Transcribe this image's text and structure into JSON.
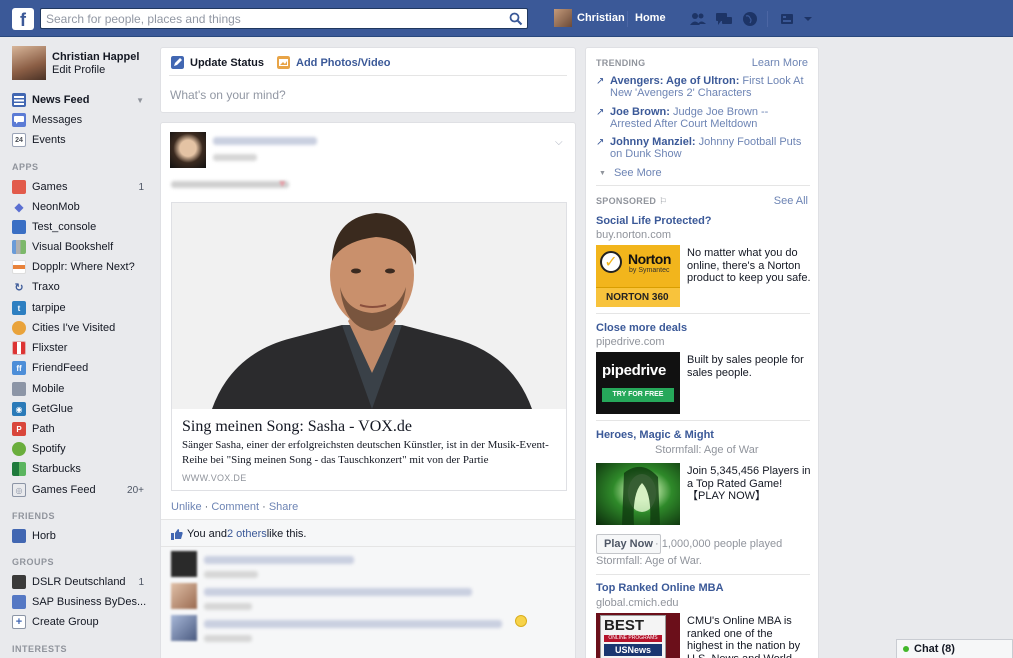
{
  "topbar": {
    "logo": "f",
    "search_placeholder": "Search for people, places and things",
    "user_name": "Christian",
    "home_label": "Home"
  },
  "profile": {
    "name": "Christian Happel",
    "edit_label": "Edit Profile"
  },
  "nav": {
    "favorites": [
      {
        "label": "News Feed",
        "icon": "newsfeed-icon"
      },
      {
        "label": "Messages",
        "icon": "messages-icon"
      },
      {
        "label": "Events",
        "icon": "events-icon",
        "icon_text": "24"
      }
    ],
    "apps_header": "APPS",
    "apps": [
      {
        "label": "Games",
        "count": "1"
      },
      {
        "label": "NeonMob",
        "count": ""
      },
      {
        "label": "Test_console",
        "count": ""
      },
      {
        "label": "Visual Bookshelf",
        "count": ""
      },
      {
        "label": "Dopplr: Where Next?",
        "count": ""
      },
      {
        "label": "Traxo",
        "count": ""
      },
      {
        "label": "tarpipe",
        "count": ""
      },
      {
        "label": "Cities I've Visited",
        "count": ""
      },
      {
        "label": "Flixster",
        "count": ""
      },
      {
        "label": "FriendFeed",
        "count": ""
      },
      {
        "label": "Mobile",
        "count": ""
      },
      {
        "label": "GetGlue",
        "count": ""
      },
      {
        "label": "Path",
        "count": ""
      },
      {
        "label": "Spotify",
        "count": ""
      },
      {
        "label": "Starbucks",
        "count": ""
      },
      {
        "label": "Games Feed",
        "count": "20+"
      }
    ],
    "friends_header": "FRIENDS",
    "friends": [
      {
        "label": "Horb"
      }
    ],
    "groups_header": "GROUPS",
    "groups": [
      {
        "label": "DSLR Deutschland",
        "count": "1"
      },
      {
        "label": "SAP Business ByDes...",
        "count": ""
      },
      {
        "label": "Create Group",
        "count": ""
      }
    ],
    "interests_header": "INTERESTS"
  },
  "composer": {
    "tab_status": "Update Status",
    "tab_photo": "Add Photos/Video",
    "placeholder": "What's on your mind?"
  },
  "story": {
    "link": {
      "title": "Sing meinen Song: Sasha - VOX.de",
      "description": "Sänger Sasha, einer der erfolgreichsten deutschen Künstler, ist in der Musik-Event-Reihe bei \"Sing meinen Song - das Tauschkonzert\" mit von der Partie",
      "source": "WWW.VOX.DE"
    },
    "actions": {
      "unlike": "Unlike",
      "sep1": " · ",
      "comment": "Comment",
      "sep2": " · ",
      "share": "Share"
    },
    "likes": {
      "prefix": "You and ",
      "others": "2 others",
      "suffix": " like this."
    }
  },
  "right": {
    "trending_header": "TRENDING",
    "learn_more": "Learn More",
    "trends": [
      {
        "topic": "Avengers: Age of Ultron:",
        "text": " First Look At New 'Avengers 2' Characters"
      },
      {
        "topic": "Joe Brown:",
        "text": " Judge Joe Brown -- Arrested After Court Meltdown"
      },
      {
        "topic": "Johnny Manziel:",
        "text": " Johnny Football Puts on Dunk Show"
      }
    ],
    "see_more": "See More",
    "sponsored_header": "SPONSORED",
    "see_all": "See All",
    "ads": [
      {
        "title": "Social Life Protected?",
        "url": "buy.norton.com",
        "text": "No matter what you do online, there's a Norton product to keep you safe."
      },
      {
        "title": "Close more deals",
        "url": "pipedrive.com",
        "text": "Built by sales people for sales people."
      },
      {
        "title": "Heroes, Magic & Might",
        "url": "Stormfall: Age of War",
        "text": "Join 5,345,456 Players in a Top Rated Game! 【PLAY NOW】"
      },
      {
        "title": "Top Ranked Online MBA",
        "url": "global.cmich.edu",
        "text": "CMU's Online MBA is ranked one of the highest in the nation by U.S. News and World Report!"
      }
    ],
    "norton_brand": "Norton",
    "norton_sub": "by Symantec",
    "norton_360": "NORTON 360",
    "pipedrive_brand": "pipedrive",
    "pipedrive_cta": "TRY FOR FREE",
    "play_now": "Play Now",
    "played_text": " · 1,000,000 people played",
    "played_sub": "Stormfall: Age of War.",
    "mba_best": "BEST",
    "mba_programs": "ONLINE PROGRAMS",
    "mba_usnews": "USNews"
  },
  "chat": {
    "label": "Chat (8)"
  },
  "colors": {
    "brand": "#3b5998",
    "link": "#6d84b4",
    "background": "#e9eaed"
  }
}
